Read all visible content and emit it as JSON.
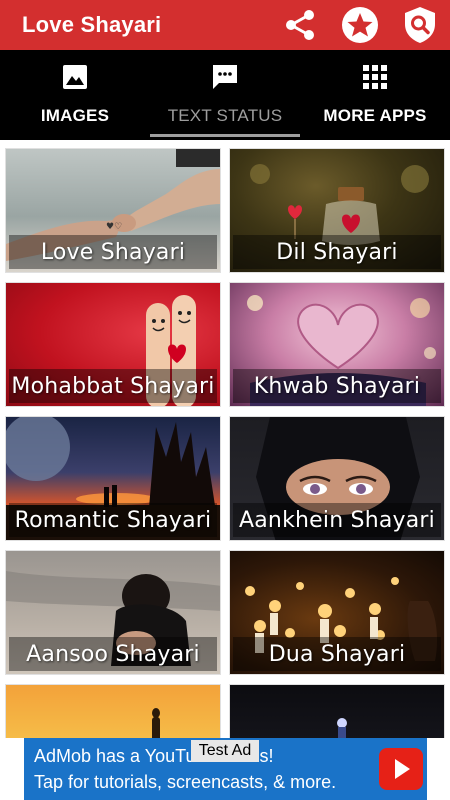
{
  "appbar": {
    "title": "Love Shayari",
    "bg_color": "#d32f2f",
    "actions": [
      {
        "icon": "share-icon"
      },
      {
        "icon": "star-icon"
      },
      {
        "icon": "shield-search-icon"
      }
    ]
  },
  "tabs": [
    {
      "label": "IMAGES",
      "icon": "image-icon",
      "active": false
    },
    {
      "label": "TEXT STATUS",
      "icon": "message-icon",
      "active": true
    },
    {
      "label": "MORE APPS",
      "icon": "apps-grid-icon",
      "active": false
    }
  ],
  "categories": [
    {
      "label": "Love Shayari"
    },
    {
      "label": "Dil Shayari"
    },
    {
      "label": "Mohabbat Shayari"
    },
    {
      "label": "Khwab Shayari"
    },
    {
      "label": "Romantic Shayari"
    },
    {
      "label": "Aankhein Shayari"
    },
    {
      "label": "Aansoo Shayari"
    },
    {
      "label": "Dua Shayari"
    }
  ],
  "ad": {
    "line1": "AdMob has a YouTube series!",
    "line2": "Tap for tutorials, screencasts, & more.",
    "badge": "Test Ad",
    "color": "#1a73c8"
  }
}
